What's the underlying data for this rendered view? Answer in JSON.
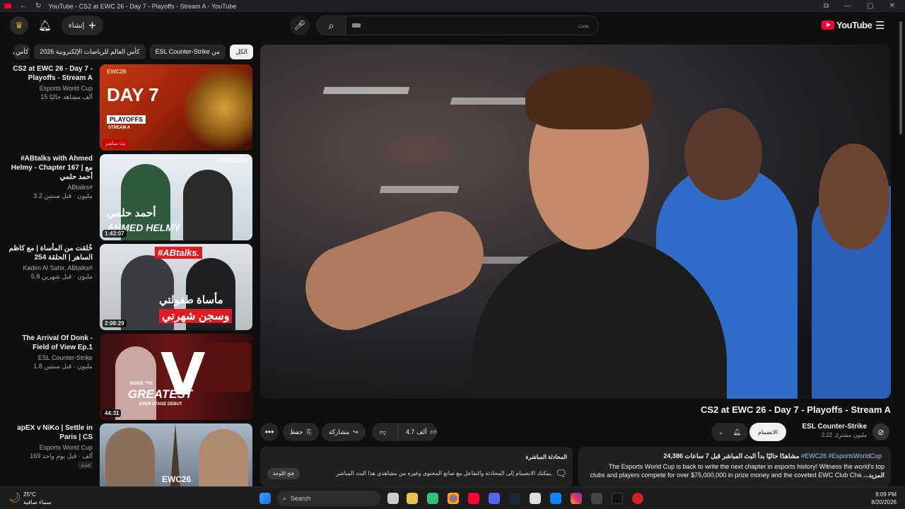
{
  "titlebar": {
    "title": "YouTube - CS2 at EWC 26 - Day 7 - Playoffs - Stream A - YouTube"
  },
  "masthead": {
    "create_label": "إنشاء",
    "search_placeholder": "بحث",
    "logo_text": "YouTube"
  },
  "chips": [
    {
      "label": "الكل",
      "active": true
    },
    {
      "label": "من ESL Counter-Strike"
    },
    {
      "label": "كأس العالم للرياضات الإلكترونية 2026"
    },
    {
      "label": "كأس"
    }
  ],
  "recommendations": [
    {
      "title": "CS2 at EWC 26 - Day 7 - Playoffs - Stream A",
      "channel": "Esports World Cup",
      "meta": "15 ألف مشاهد حاليًا",
      "badge": "بث مباشر",
      "thumb": {
        "t1": "DAY 7",
        "t2": "PLAYOFFS",
        "t3": "STREAM A",
        "brand": "EWC26"
      }
    },
    {
      "title": "#ABtalks with Ahmed Helmy - Chapter 167 | مع أحمد حلمي",
      "channel": "ABtalks#",
      "meta": "3.2 مليون · قبل سنتين",
      "duration": "1:43:07",
      "thumb": {
        "t1": "#ABtalks",
        "t2": "أحمد حلمي",
        "t3": "AHMED HELMY"
      }
    },
    {
      "title": "خُلقت من المأساة | مع كاظم الساهر | الحلقة 254",
      "channel": "Kadim Al Sahir, ABtalks#",
      "meta": "5.8 مليون · قبل شهرين",
      "duration": "2:08:29",
      "thumb": {
        "t1": "#ABtalks.",
        "t2": "مأساة طفولتي",
        "t3": "وسجن شهرتي"
      }
    },
    {
      "title": "The Arrival Of Donk - Field of View Ep.1",
      "channel": "ESL Counter-Strike",
      "meta": "1.8 مليون · قبل سنتين",
      "duration": "44:31",
      "thumb": {
        "t1": "V",
        "t2": "INSIDE THE",
        "t3": "GREATEST",
        "t4": "EVER STAGE DEBUT"
      }
    },
    {
      "title": "apEX v NiKo | Settle in Paris | CS",
      "channel": "Esports World Cup",
      "meta": "169 ألف · قبل يوم واحد",
      "badge2": "جديد",
      "thumb": {
        "t1": "EWC26"
      }
    }
  ],
  "video": {
    "title": "CS2 at EWC 26 - Day 7 - Playoffs - Stream A",
    "channel": "ESL Counter-Strike",
    "subscribers": "2.22 مليون مشترك",
    "subscribe": "الانضمام",
    "likes": "4.7 ألف",
    "share": "مشاركة",
    "save": "حفظ"
  },
  "livechat": {
    "title": "المحادثة المباشرة",
    "body": "يمكنك الانضمام إلى المحادثة والتفاعل مع صانع المحتوى وغيره من مشاهدي هذا البث المباشر.",
    "button": "فتح اللوحة"
  },
  "description": {
    "stats": "24,386 مشاهدًا حاليًا بدأ البث المباشر قبل 7 ساعات",
    "tags": "#EWC26 #EsportsWorldCup",
    "line1": "The Esports World Cup is back to write the next chapter in esports history! Witness the world's top",
    "line2": "clubs and players compete for over $75,000,000 in prize money and the coveted EWC Club Cha",
    "more": "...المزيد"
  },
  "taskbar": {
    "temp": "25°C",
    "weather": "سماء صافية",
    "search": "Search",
    "time": "9:09 PM",
    "date": "8/20/2026"
  }
}
